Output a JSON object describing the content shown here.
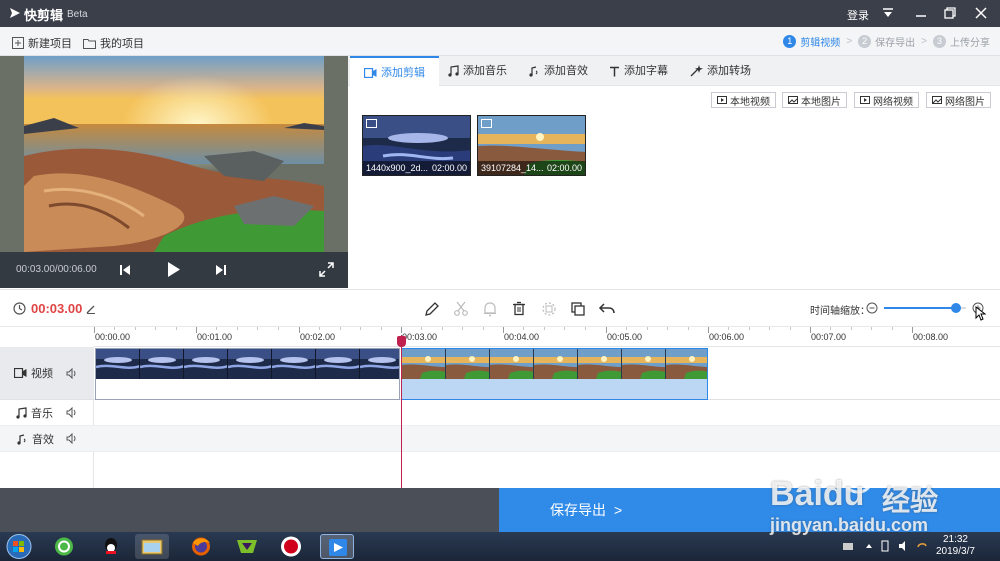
{
  "titlebar": {
    "app_name": "快剪辑",
    "beta": "Beta",
    "login": "登录"
  },
  "toolbar": {
    "new_project": "新建项目",
    "my_projects": "我的项目",
    "steps": [
      {
        "num": "1",
        "label": "剪辑视频",
        "active": true
      },
      {
        "num": "2",
        "label": "保存导出",
        "active": false
      },
      {
        "num": "3",
        "label": "上传分享",
        "active": false
      }
    ]
  },
  "preview": {
    "time": "00:03.00/00:06.00"
  },
  "media": {
    "tabs": [
      {
        "label": "添加剪辑",
        "icon": "video-icon",
        "active": true
      },
      {
        "label": "添加音乐",
        "icon": "music-icon",
        "active": false
      },
      {
        "label": "添加音效",
        "icon": "sound-effect-icon",
        "active": false
      },
      {
        "label": "添加字幕",
        "icon": "text-icon",
        "active": false
      },
      {
        "label": "添加转场",
        "icon": "transition-icon",
        "active": false
      }
    ],
    "sources": [
      "本地视频",
      "本地图片",
      "网络视频",
      "网络图片"
    ],
    "thumbs": [
      {
        "name": "1440x900_2d...",
        "duration": "02:00.00"
      },
      {
        "name": "39107284_14...",
        "duration": "02:00.00"
      }
    ]
  },
  "timeline": {
    "current_time": "00:03.00",
    "zoom_label": "时间轴缩放：",
    "zoom_level": 0.88,
    "ticks": [
      "00:00.00",
      "00:01.00",
      "00:02.00",
      "00:03.00",
      "00:04.00",
      "00:05.00",
      "00:06.00",
      "00:07.00",
      "00:08.00"
    ],
    "tracks": {
      "video": "视频",
      "music": "音乐",
      "sfx": "音效"
    }
  },
  "bottom": {
    "save_export": "保存导出"
  },
  "taskbar": {
    "time": "21:32",
    "date": "2019/3/7"
  },
  "watermark": {
    "brand": "Baidu",
    "brand_cn": "经验",
    "url": "jingyan.baidu.com"
  },
  "colors": {
    "accent": "#2f87e8",
    "time_red": "#e04545",
    "playhead": "#c0214f",
    "titlebar": "#3b3f4a"
  }
}
